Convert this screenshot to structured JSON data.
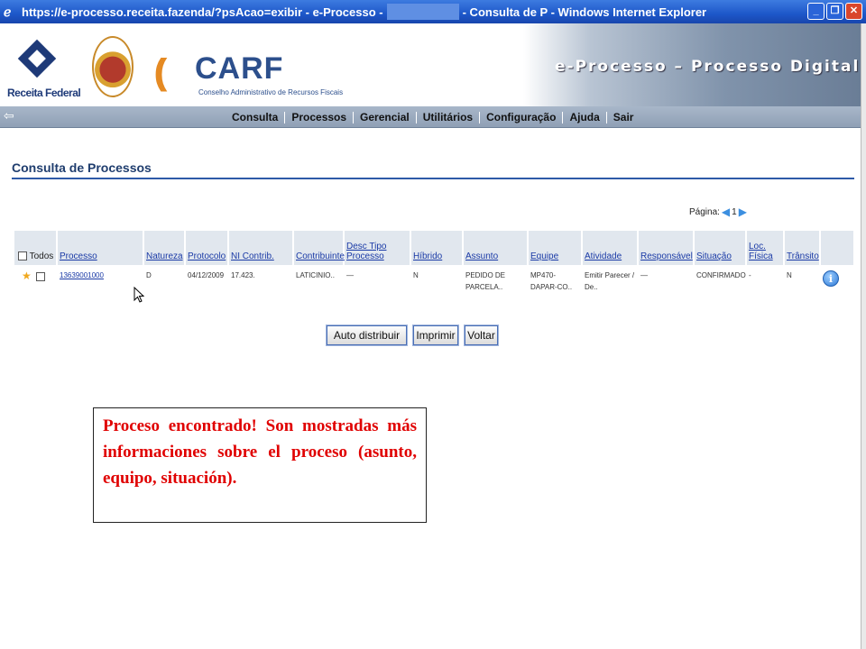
{
  "window": {
    "title_url": "https://e-processo.receita.fazenda/?psAcao=exibir - e-Processo -",
    "title_rest": "- Consulta de P - Windows Internet Explorer"
  },
  "header": {
    "rf_logo_text": "Receita Federal",
    "carf_name": "CARF",
    "carf_subtitle": "Conselho Administrativo de Recursos Fiscais",
    "system_title": "e-Processo – Processo Digital"
  },
  "nav": {
    "items": [
      "Consulta",
      "Processos",
      "Gerencial",
      "Utilitários",
      "Configuração",
      "Ajuda",
      "Sair"
    ]
  },
  "page": {
    "title": "Consulta de Processos",
    "pager_label": "Página:",
    "pager_value": "1"
  },
  "table": {
    "headers": {
      "todos": "Todos",
      "processo": "Processo",
      "natureza": "Natureza",
      "protocolo": "Protocolo",
      "ni_contrib": "NI Contrib.",
      "contribuinte": "Contribuinte",
      "desc_tipo_1": "Desc Tipo",
      "desc_tipo_2": "Processo",
      "hibrido": "Híbrido",
      "assunto": "Assunto",
      "equipe": "Equipe",
      "atividade": "Atividade",
      "responsavel": "Responsável",
      "situacao": "Situação",
      "loc_1": "Loc.",
      "loc_2": "Física",
      "transito": "Trânsito"
    },
    "row": {
      "processo": "13639001000",
      "natureza": "D",
      "protocolo": "04/12/2009",
      "ni_contrib": "17.423.",
      "contribuinte": "LATICINIO..",
      "desc_tipo": "—",
      "hibrido": "N",
      "assunto_1": "PEDIDO DE",
      "assunto_2": "PARCELA..",
      "equipe_1": "MP470-",
      "equipe_2": "DAPAR-CO..",
      "atividade_1": "Emitir Parecer /",
      "atividade_2": "De..",
      "responsavel": "—",
      "situacao": "CONFIRMADO",
      "loc_fisica": "-",
      "transito": "N"
    }
  },
  "buttons": {
    "auto_distribuir": "Auto distribuir",
    "imprimir": "Imprimir",
    "voltar": "Voltar"
  },
  "annotation": "Proceso encontrado! Son mostradas más informaciones sobre el proceso (asunto, equipo, situación).",
  "colors": {
    "annotation_text": "#e00000",
    "link": "#1a3aa6",
    "title_bar": "#1d57c9"
  }
}
